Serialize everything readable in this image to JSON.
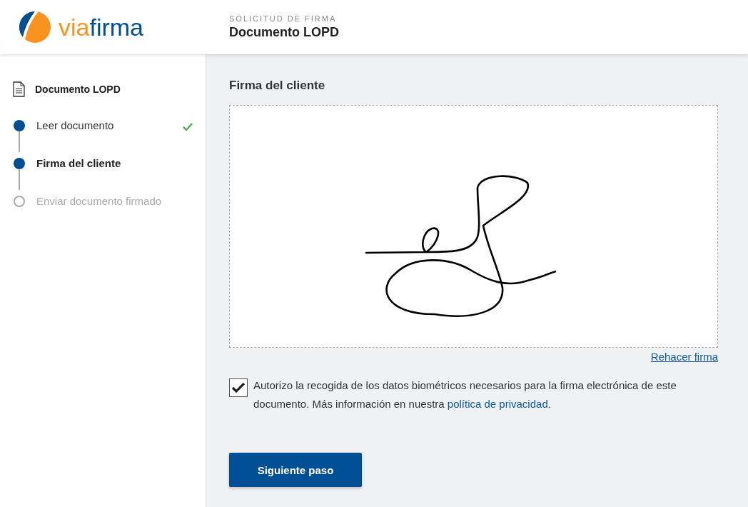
{
  "logo": {
    "prefix": "via",
    "suffix": "firma"
  },
  "header": {
    "eyebrow": "SOLICITUD DE FIRMA",
    "title": "Documento LOPD"
  },
  "sidebar": {
    "document": "Documento LOPD",
    "steps": [
      {
        "label": "Leer documento",
        "kind": "done"
      },
      {
        "label": "Firma del cliente",
        "kind": "current"
      },
      {
        "label": "Enviar documento firmado",
        "kind": "pending"
      }
    ]
  },
  "main": {
    "title": "Firma del cliente",
    "redo_link": "Rehacer firma",
    "consent": {
      "checked": true,
      "text_before": "Autorizo la recogida de los datos biométricos necesarios para la firma electrónica de este documento. Más información en nuestra ",
      "link": "política de privacidad",
      "text_after": "."
    },
    "button": "Siguiente paso"
  }
}
